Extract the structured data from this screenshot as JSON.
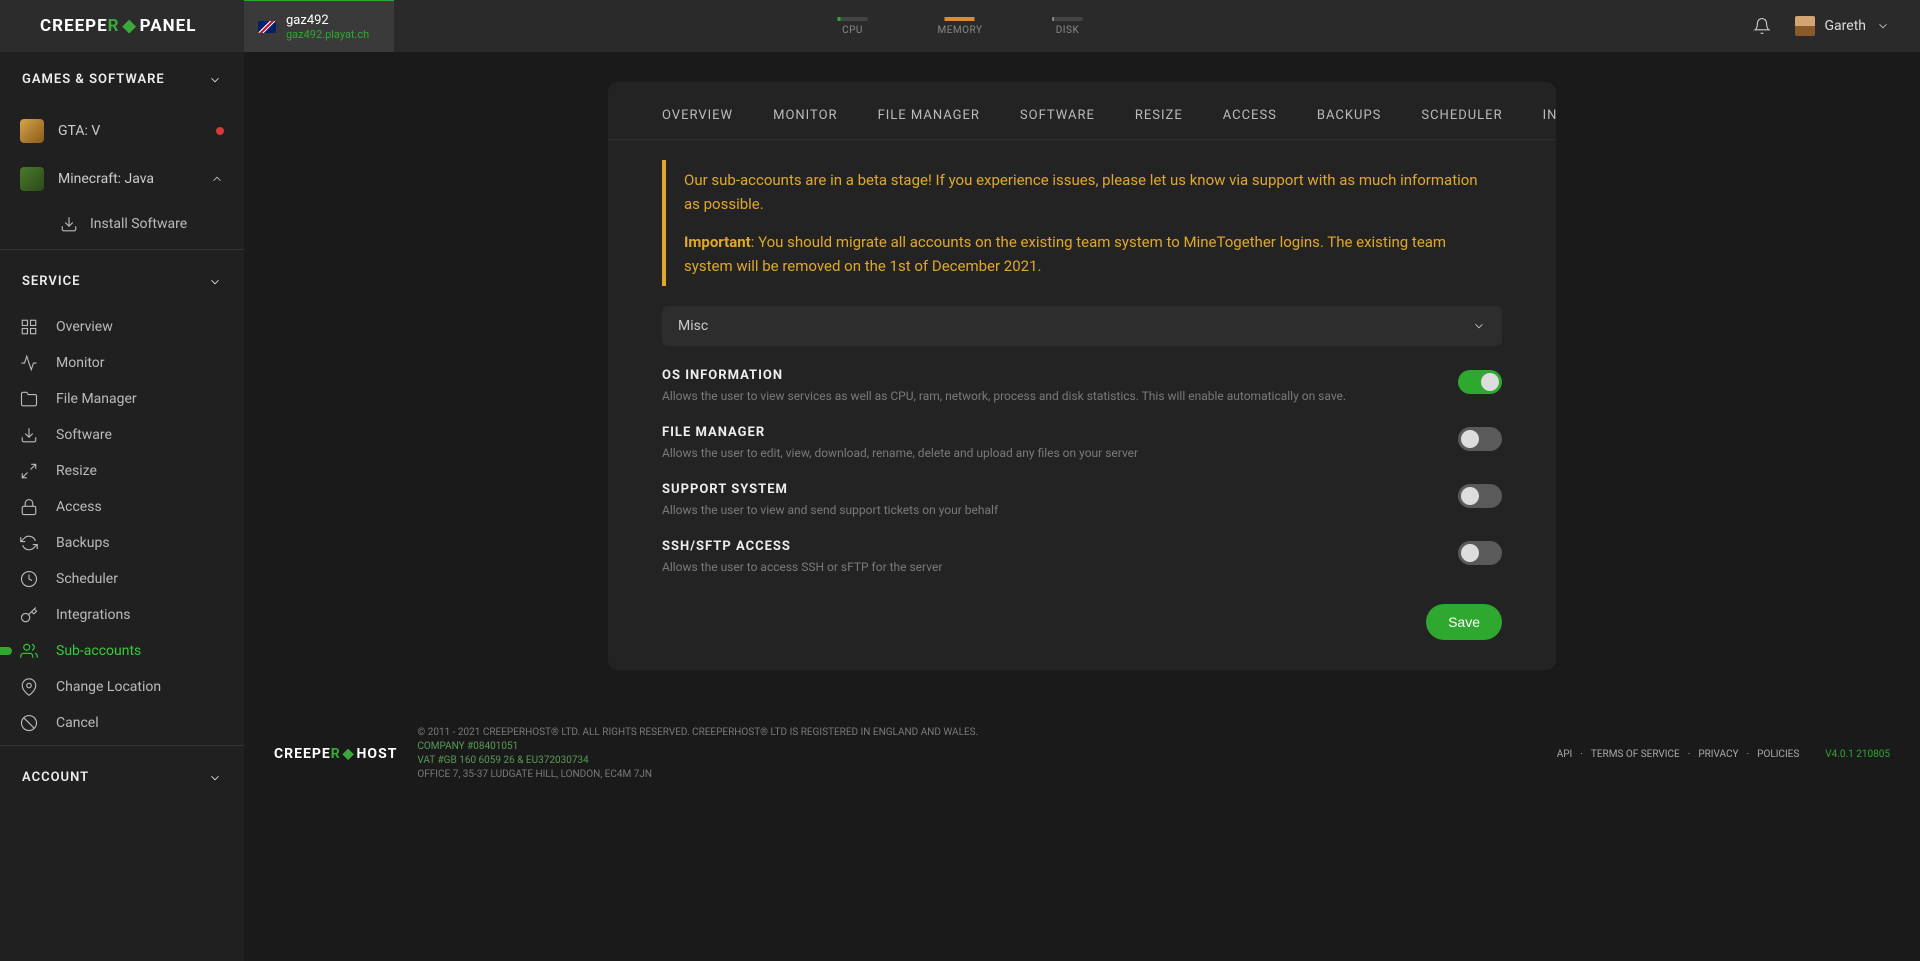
{
  "brand": {
    "part1": "CREEPE",
    "accent": "R",
    "part2": "PANEL"
  },
  "server": {
    "name": "gaz492",
    "host": "gaz492.playat.ch"
  },
  "resources": [
    {
      "label": "CPU"
    },
    {
      "label": "MEMORY"
    },
    {
      "label": "DISK"
    }
  ],
  "user": {
    "name": "Gareth"
  },
  "sidebar": {
    "games_header": "GAMES & SOFTWARE",
    "games": [
      {
        "label": "GTA: V"
      },
      {
        "label": "Minecraft: Java"
      }
    ],
    "install_label": "Install Software",
    "service_header": "SERVICE",
    "service_items": [
      {
        "label": "Overview"
      },
      {
        "label": "Monitor"
      },
      {
        "label": "File Manager"
      },
      {
        "label": "Software"
      },
      {
        "label": "Resize"
      },
      {
        "label": "Access"
      },
      {
        "label": "Backups"
      },
      {
        "label": "Scheduler"
      },
      {
        "label": "Integrations"
      },
      {
        "label": "Sub-accounts"
      },
      {
        "label": "Change Location"
      },
      {
        "label": "Cancel"
      }
    ],
    "account_header": "ACCOUNT"
  },
  "tabs": [
    "OVERVIEW",
    "MONITOR",
    "FILE MANAGER",
    "SOFTWARE",
    "RESIZE",
    "ACCESS",
    "BACKUPS",
    "SCHEDULER",
    "INTEG"
  ],
  "notice": {
    "line1": "Our sub-accounts are in a beta stage! If you experience issues, please let us know via support with as much information as possible.",
    "important_label": "Important",
    "line2": ": You should migrate all accounts on the existing team system to MineTogether logins. The existing team system will be removed on the 1st of December 2021."
  },
  "dropdown_label": "Misc",
  "permissions": [
    {
      "title": "OS INFORMATION",
      "desc": "Allows the user to view services as well as CPU, ram, network, process and disk statistics. This will enable automatically on save.",
      "on": true
    },
    {
      "title": "FILE MANAGER",
      "desc": "Allows the user to edit, view, download, rename, delete and upload any files on your server",
      "on": false
    },
    {
      "title": "SUPPORT SYSTEM",
      "desc": "Allows the user to view and send support tickets on your behalf",
      "on": false
    },
    {
      "title": "SSH/SFTP ACCESS",
      "desc": "Allows the user to access SSH or sFTP for the server",
      "on": false
    }
  ],
  "save_label": "Save",
  "footer": {
    "brand_part1": "CREEPE",
    "brand_accent": "R",
    "brand_part2": "HOST",
    "copyright": "© 2011 - 2021 CREEPERHOST® LTD. ALL RIGHTS RESERVED. CREEPERHOST® LTD IS REGISTERED IN ENGLAND AND WALES.",
    "company": "COMPANY #08401051",
    "vat": "VAT #GB 160 6059 26 & EU372030734",
    "address": "OFFICE 7, 35-37 LUDGATE HILL, LONDON, EC4M 7JN",
    "links": [
      "API",
      "TERMS OF SERVICE",
      "PRIVACY",
      "POLICIES"
    ],
    "version": "V4.0.1 210805"
  }
}
